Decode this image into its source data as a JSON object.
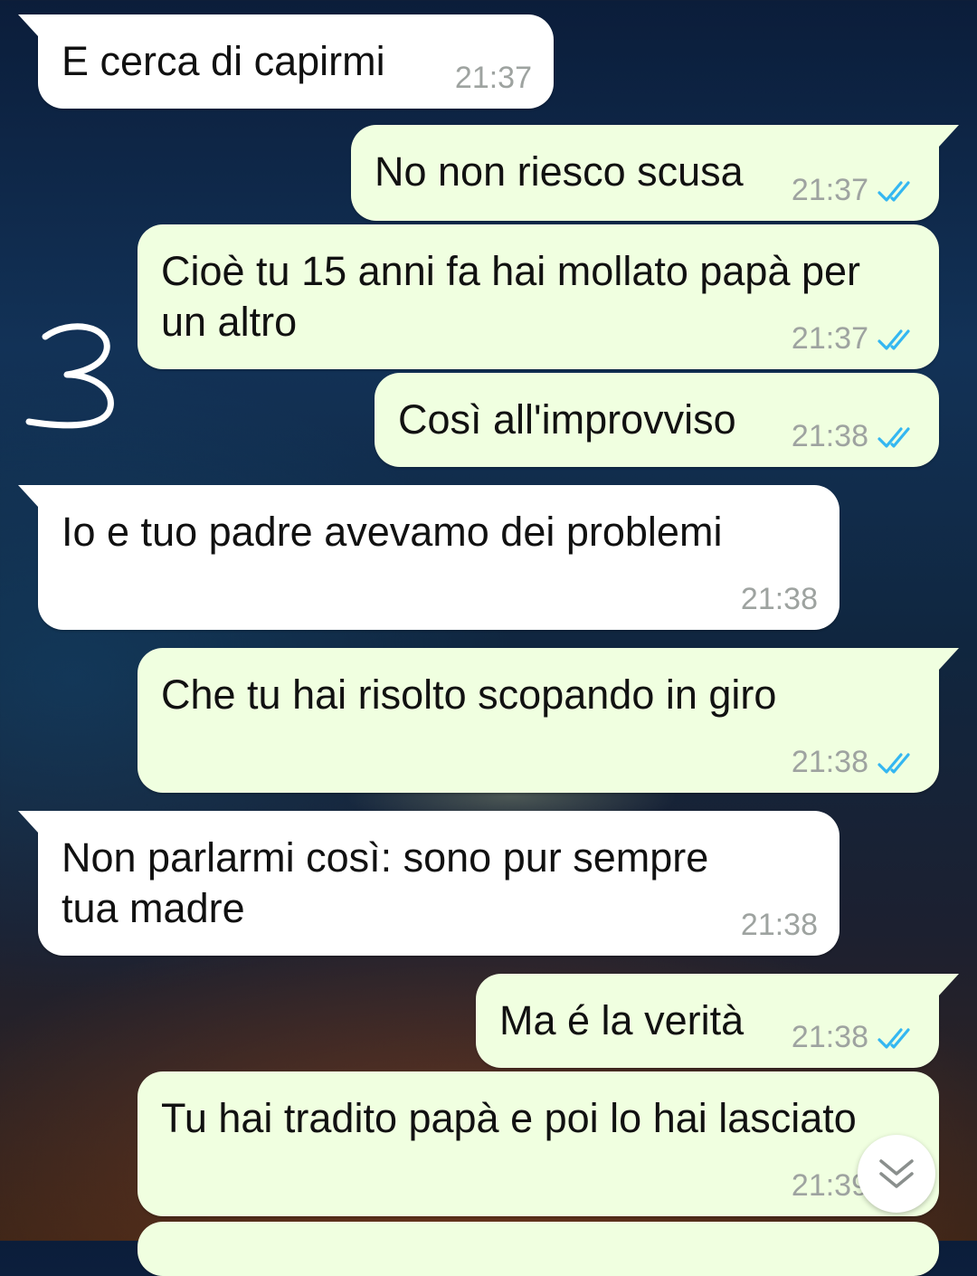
{
  "messages": [
    {
      "text": "E cerca di capirmi",
      "time": "21:37",
      "dir": "in"
    },
    {
      "text": "No non riesco scusa",
      "time": "21:37",
      "dir": "out",
      "status": "read"
    },
    {
      "text": "Cioè tu 15 anni fa hai mollato papà per un altro",
      "time": "21:37",
      "dir": "out",
      "status": "read"
    },
    {
      "text": "Così all'improvviso",
      "time": "21:38",
      "dir": "out",
      "status": "read"
    },
    {
      "text": "Io e tuo padre avevamo dei problemi",
      "time": "21:38",
      "dir": "in"
    },
    {
      "text": "Che tu hai risolto scopando in giro",
      "time": "21:38",
      "dir": "out",
      "status": "read"
    },
    {
      "text": "Non parlarmi così: sono pur sempre tua madre",
      "time": "21:38",
      "dir": "in"
    },
    {
      "text": "Ma é la verità",
      "time": "21:38",
      "dir": "out",
      "status": "read"
    },
    {
      "text": "Tu hai tradito papà e poi lo hai lasciato",
      "time": "21:39",
      "dir": "out",
      "status": "read"
    }
  ],
  "annotation": "3",
  "colors": {
    "incoming_bubble": "#ffffff",
    "outgoing_bubble": "#f0ffe0",
    "read_ticks": "#34b7f1",
    "timestamp": "#9ea3a0"
  },
  "icons": {
    "read_receipt": "double-check-icon",
    "scroll_down": "double-chevron-down-icon"
  }
}
